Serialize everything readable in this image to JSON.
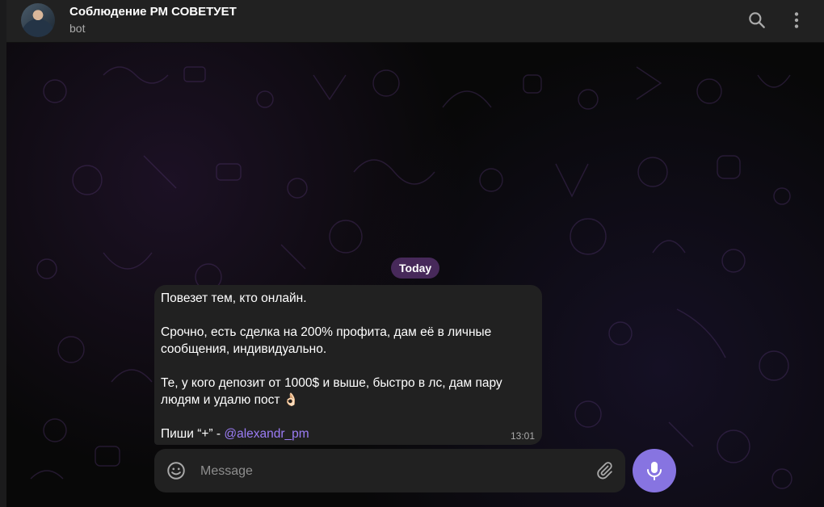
{
  "header": {
    "title": "Соблюдение РМ СОВЕТУЕТ",
    "subtitle": "bot",
    "icons": {
      "search": "search-icon",
      "menu": "more-vertical-icon"
    }
  },
  "chat": {
    "date_separator": "Today",
    "message": {
      "lines": [
        "Повезет тем, кто онлайн.",
        "",
        "Срочно, есть сделка на 200% профита, дам её в личные",
        "сообщения, индивидуально.",
        "",
        "Те, у кого депозит от 1000$ и выше, быстро в лс, дам пару",
        "людям и удалю пост 👌🏻",
        ""
      ],
      "last_prefix": "Пиши “+” - ",
      "mention": "@alexandr_pm",
      "time": "13:01"
    }
  },
  "composer": {
    "placeholder": "Message",
    "value": "",
    "icons": {
      "emoji": "smile-icon",
      "attach": "paperclip-icon",
      "mic": "microphone-icon"
    }
  },
  "colors": {
    "accent": "#8774e1",
    "header_bg": "#212121",
    "bubble_bg": "#212121",
    "date_pill_bg": "#47295a",
    "mention": "#9b7cf5"
  }
}
